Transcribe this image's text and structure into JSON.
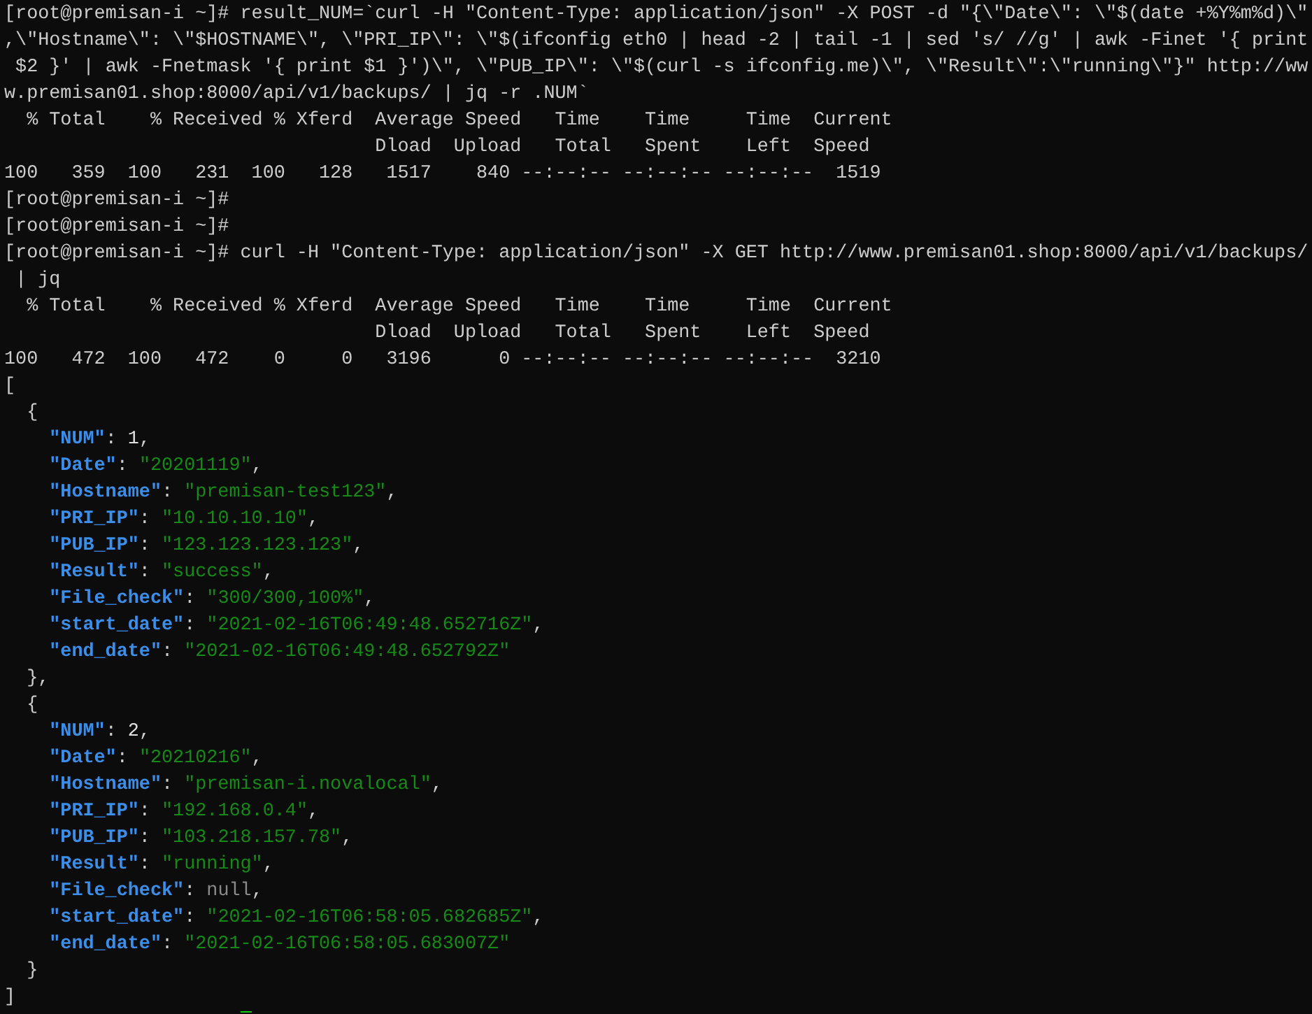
{
  "terminal": {
    "lines": [
      {
        "text": "[root@premisan-i ~]# result_NUM=`curl -H \"Content-Type: application/json\" -X POST -d \"{\\\"Date\\\": \\\"$(date +%Y%m%d)\\\""
      },
      {
        "text": ",\\\"Hostname\\\": \\\"$HOSTNAME\\\", \\\"PRI_IP\\\": \\\"$(ifconfig eth0 | head -2 | tail -1 | sed 's/ //g' | awk -Finet '{ print"
      },
      {
        "text": " $2 }' | awk -Fnetmask '{ print $1 }')\\\", \\\"PUB_IP\\\": \\\"$(curl -s ifconfig.me)\\\", \\\"Result\\\":\\\"running\\\"}\" http://ww"
      },
      {
        "text": "w.premisan01.shop:8000/api/v1/backups/ | jq -r .NUM`"
      },
      {
        "text": "  % Total    % Received % Xferd  Average Speed   Time    Time     Time  Current"
      },
      {
        "text": "                                 Dload  Upload   Total   Spent    Left  Speed"
      },
      {
        "text": "100   359  100   231  100   128   1517    840 --:--:-- --:--:-- --:--:--  1519"
      },
      {
        "text": "[root@premisan-i ~]#"
      },
      {
        "text": "[root@premisan-i ~]#"
      },
      {
        "text": "[root@premisan-i ~]# curl -H \"Content-Type: application/json\" -X GET http://www.premisan01.shop:8000/api/v1/backups/"
      },
      {
        "text": " | jq"
      },
      {
        "text": "  % Total    % Received % Xferd  Average Speed   Time    Time     Time  Current"
      },
      {
        "text": "                                 Dload  Upload   Total   Spent    Left  Speed"
      },
      {
        "text": "100   472  100   472    0     0   3196      0 --:--:-- --:--:-- --:--:--  3210"
      }
    ],
    "json_output": {
      "open": "[",
      "close": "]",
      "objects": [
        {
          "open": "{",
          "close": "},",
          "fields": [
            {
              "key": "\"NUM\"",
              "colon": ":",
              "value": "1",
              "kind": "number",
              "sep": ","
            },
            {
              "key": "\"Date\"",
              "colon": ":",
              "value": "\"20201119\"",
              "kind": "string",
              "sep": ","
            },
            {
              "key": "\"Hostname\"",
              "colon": ":",
              "value": "\"premisan-test123\"",
              "kind": "string",
              "sep": ","
            },
            {
              "key": "\"PRI_IP\"",
              "colon": ":",
              "value": "\"10.10.10.10\"",
              "kind": "string",
              "sep": ","
            },
            {
              "key": "\"PUB_IP\"",
              "colon": ":",
              "value": "\"123.123.123.123\"",
              "kind": "string",
              "sep": ","
            },
            {
              "key": "\"Result\"",
              "colon": ":",
              "value": "\"success\"",
              "kind": "string",
              "sep": ","
            },
            {
              "key": "\"File_check\"",
              "colon": ":",
              "value": "\"300/300,100%\"",
              "kind": "string",
              "sep": ","
            },
            {
              "key": "\"start_date\"",
              "colon": ":",
              "value": "\"2021-02-16T06:49:48.652716Z\"",
              "kind": "string",
              "sep": ","
            },
            {
              "key": "\"end_date\"",
              "colon": ":",
              "value": "\"2021-02-16T06:49:48.652792Z\"",
              "kind": "string"
            }
          ]
        },
        {
          "open": "{",
          "close": "}",
          "fields": [
            {
              "key": "\"NUM\"",
              "colon": ":",
              "value": "2",
              "kind": "number",
              "sep": ","
            },
            {
              "key": "\"Date\"",
              "colon": ":",
              "value": "\"20210216\"",
              "kind": "string",
              "sep": ","
            },
            {
              "key": "\"Hostname\"",
              "colon": ":",
              "value": "\"premisan-i.novalocal\"",
              "kind": "string",
              "sep": ","
            },
            {
              "key": "\"PRI_IP\"",
              "colon": ":",
              "value": "\"192.168.0.4\"",
              "kind": "string",
              "sep": ","
            },
            {
              "key": "\"PUB_IP\"",
              "colon": ":",
              "value": "\"103.218.157.78\"",
              "kind": "string",
              "sep": ","
            },
            {
              "key": "\"Result\"",
              "colon": ":",
              "value": "\"running\"",
              "kind": "string",
              "sep": ","
            },
            {
              "key": "\"File_check\"",
              "colon": ":",
              "value": "null",
              "kind": "null",
              "sep": ","
            },
            {
              "key": "\"start_date\"",
              "colon": ":",
              "value": "\"2021-02-16T06:58:05.682685Z\"",
              "kind": "string",
              "sep": ","
            },
            {
              "key": "\"end_date\"",
              "colon": ":",
              "value": "\"2021-02-16T06:58:05.683007Z\"",
              "kind": "string"
            }
          ]
        }
      ]
    }
  }
}
